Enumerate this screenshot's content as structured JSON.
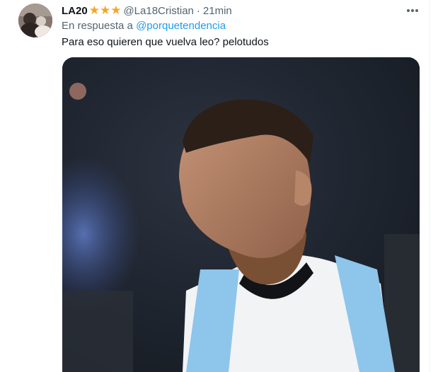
{
  "tweet": {
    "display_name": "LA20",
    "badges": [
      "star-icon",
      "star-icon",
      "star-icon"
    ],
    "handle": "@La18Cristian",
    "separator": "·",
    "time": "21min",
    "reply_prefix": "En respuesta a",
    "reply_to": "@porquetendencia",
    "text": "Para eso quieren que vuelva leo? pelotudos",
    "more_icon": "more-dots-icon"
  },
  "colors": {
    "link": "#1d9bf0",
    "secondary_text": "#536471",
    "star": "#f4a52a",
    "jersey_blue": "#8ec5ea"
  }
}
